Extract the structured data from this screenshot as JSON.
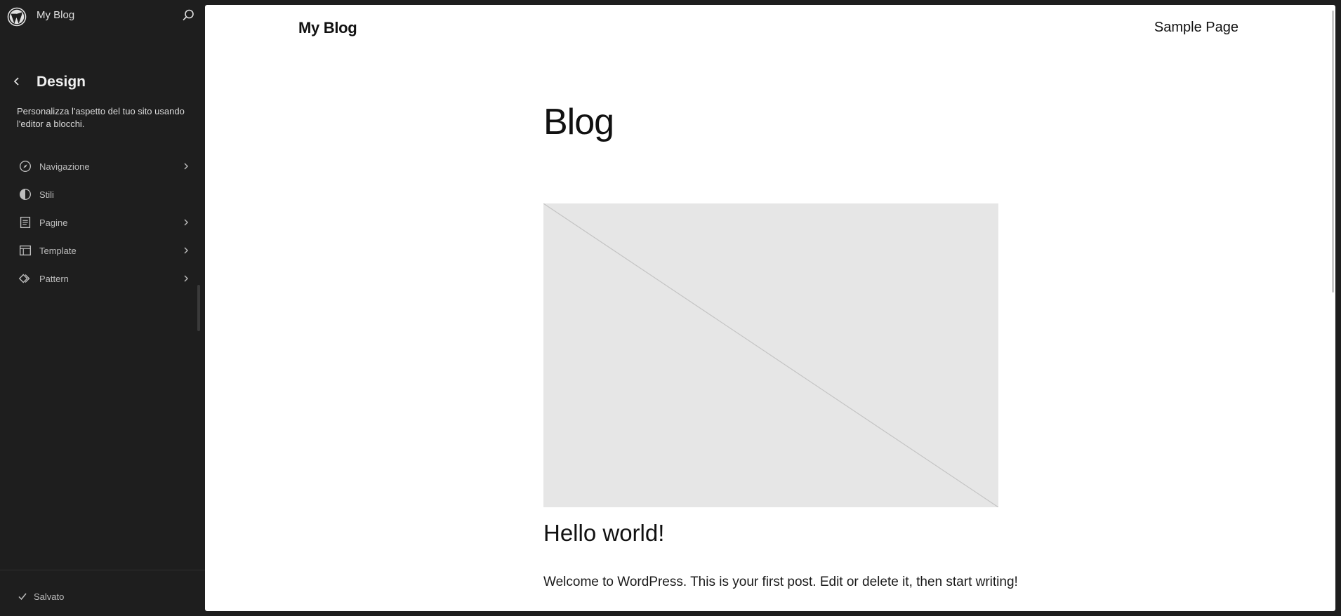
{
  "sidebar": {
    "site_name": "My Blog",
    "section_title": "Design",
    "section_description": "Personalizza l'aspetto del tuo sito usando l'editor a blocchi.",
    "items": [
      {
        "label": "Navigazione",
        "icon": "compass-icon",
        "has_chevron": true
      },
      {
        "label": "Stili",
        "icon": "half-circle-icon",
        "has_chevron": false
      },
      {
        "label": "Pagine",
        "icon": "page-icon",
        "has_chevron": true
      },
      {
        "label": "Template",
        "icon": "layout-icon",
        "has_chevron": true
      },
      {
        "label": "Pattern",
        "icon": "symbol-icon",
        "has_chevron": true
      }
    ],
    "save_status": "Salvato"
  },
  "canvas": {
    "site_title": "My Blog",
    "nav_link": "Sample Page",
    "page_heading": "Blog",
    "post_title": "Hello world!",
    "post_excerpt": "Welcome to WordPress. This is your first post. Edit or delete it, then start writing!"
  },
  "colors": {
    "sidebar_bg": "#1e1e1e",
    "canvas_bg": "#ffffff",
    "placeholder_bg": "#e6e6e6"
  }
}
